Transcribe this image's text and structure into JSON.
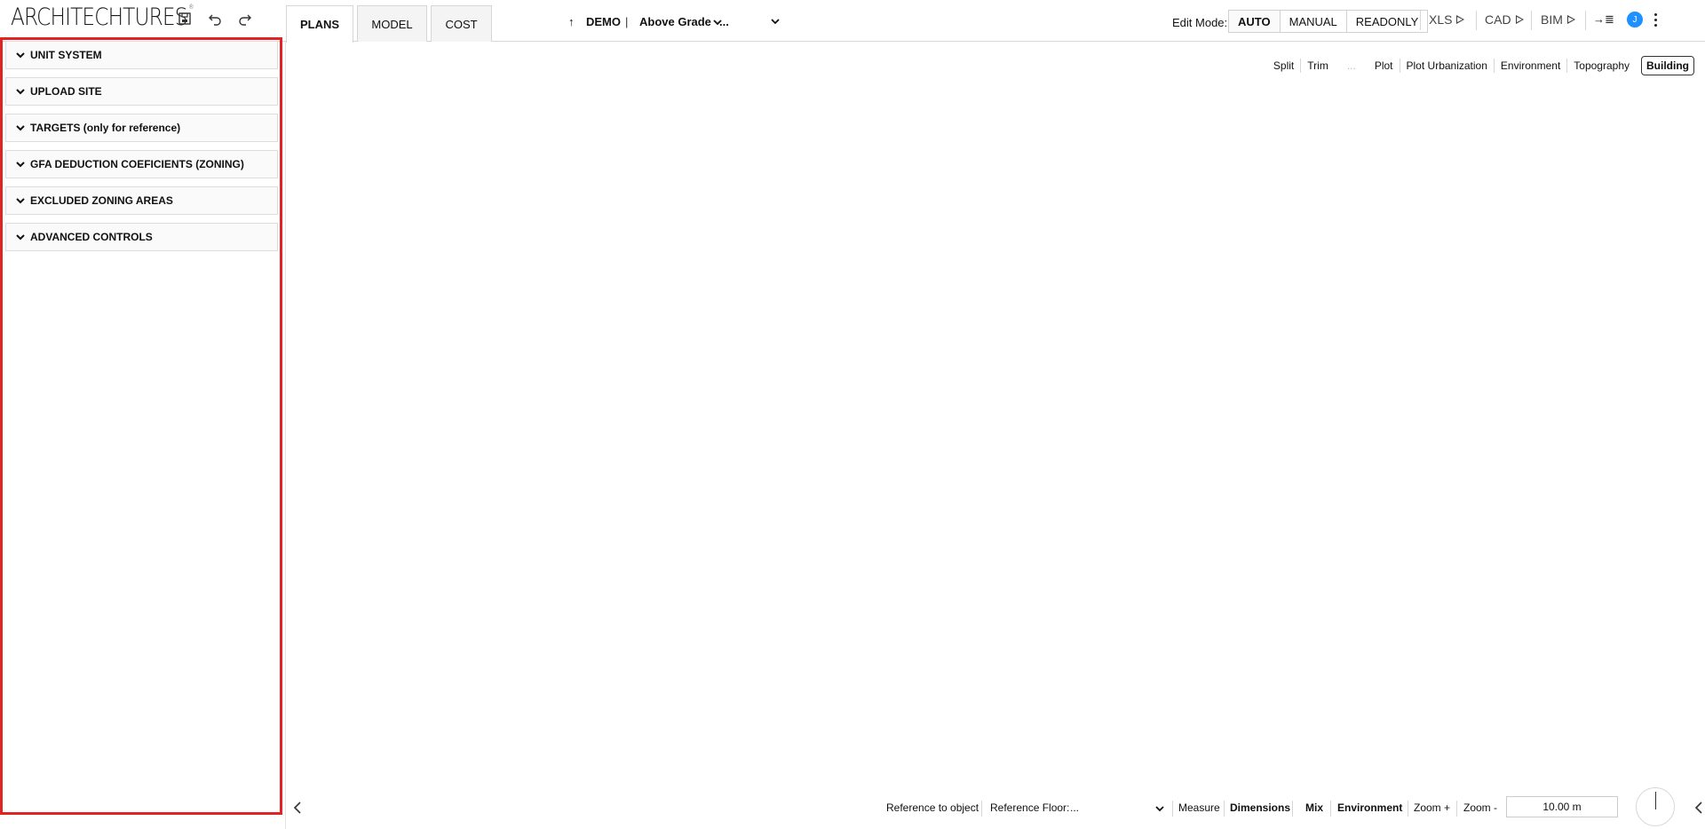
{
  "app": {
    "logo": "ARCHITECHTURES",
    "logo_mark": "®"
  },
  "header": {
    "tabs": [
      {
        "label": "PLANS",
        "active": true
      },
      {
        "label": "MODEL",
        "active": false
      },
      {
        "label": "COST",
        "active": false
      }
    ],
    "project": {
      "arrow": "↑",
      "name": "DEMO",
      "separator": "|",
      "grade": "Above Grade",
      "dropdown_value": "..."
    },
    "edit_mode": {
      "label": "Edit Mode:",
      "options": [
        "AUTO",
        "MANUAL",
        "READONLY"
      ],
      "selected": "AUTO"
    },
    "exports": [
      "XLS",
      "CAD",
      "BIM"
    ],
    "export_all_icon": "→≣",
    "avatar_initial": "J",
    "accent_color": "#1e90ff"
  },
  "sidebar": {
    "border_color": "#e02424",
    "sections": [
      "UNIT SYSTEM",
      "UPLOAD SITE",
      "TARGETS (only for reference)",
      "GFA DEDUCTION COEFICIENTS (ZONING)",
      "EXCLUDED ZONING AREAS",
      "ADVANCED CONTROLS"
    ]
  },
  "view_toolbar": {
    "items": [
      "Split",
      "Trim",
      "...",
      "Plot",
      "Plot Urbanization",
      "Environment",
      "Topography",
      "Building"
    ],
    "active": "Building"
  },
  "bottom_bar": {
    "reference_to_object": "Reference to object",
    "reference_floor_label": "Reference Floor:",
    "reference_floor_value": "...",
    "measure": "Measure",
    "dimensions": "Dimensions",
    "mix": "Mix",
    "environment": "Environment",
    "zoom_in": "Zoom +",
    "zoom_out": "Zoom -",
    "scale": "10.00 m"
  }
}
